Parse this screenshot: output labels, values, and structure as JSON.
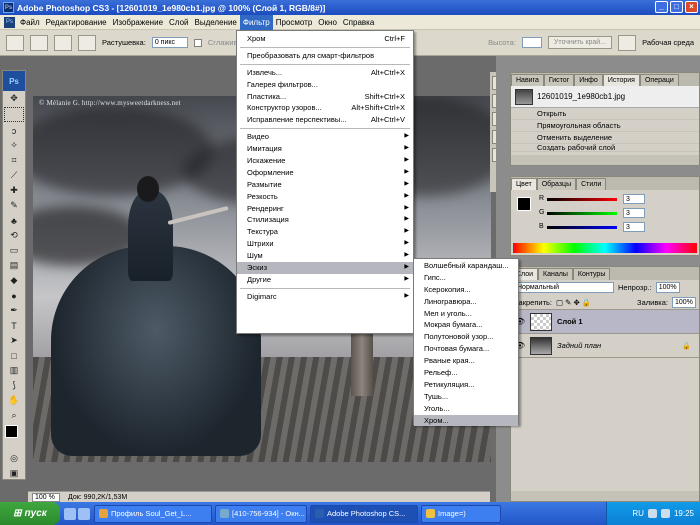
{
  "window": {
    "title": "Adobe Photoshop CS3 - [12601019_1e980cb1.jpg @ 100% (Слой 1, RGB/8#)]"
  },
  "menubar": [
    "Файл",
    "Редактирование",
    "Изображение",
    "Слой",
    "Выделение",
    "Фильтр",
    "Просмотр",
    "Окно",
    "Справка"
  ],
  "options": {
    "feather_label": "Растушевка:",
    "feather_value": "0 пикс",
    "antialias_label": "Сглаживание",
    "height_label": "Высота:",
    "refine_edge": "Уточнить край...",
    "workspace": "Рабочая среда"
  },
  "filter_menu": {
    "chrome": "Хром",
    "chrome_sc": "Ctrl+F",
    "smart": "Преобразовать для смарт-фильтров",
    "extract": "Извлечь...",
    "extract_sc": "Alt+Ctrl+X",
    "gallery": "Галерея фильтров...",
    "liquify": "Пластика...",
    "liquify_sc": "Shift+Ctrl+X",
    "pattern": "Конструктор узоров...",
    "pattern_sc": "Alt+Shift+Ctrl+X",
    "vanishing": "Исправление перспективы...",
    "vanishing_sc": "Alt+Ctrl+V",
    "video": "Видео",
    "imitation": "Имитация",
    "distort": "Искажение",
    "artistic": "Оформление",
    "blur": "Размытие",
    "sharpen": "Резкость",
    "render": "Рендеринг",
    "stylize": "Стилизация",
    "texture": "Текстура",
    "strokes": "Штрихи",
    "noise": "Шум",
    "sketch": "Эскиз",
    "other": "Другие",
    "digimarc": "Digimarc"
  },
  "sketch_menu": [
    "Волшебный карандаш...",
    "Гипс...",
    "Ксерокопия...",
    "Линогравюра...",
    "Мел и уголь...",
    "Мокрая бумага...",
    "Полутоновой узор...",
    "Почтовая бумага...",
    "Рваные края...",
    "Рельеф...",
    "Ретикуляция...",
    "Тушь...",
    "Уголь...",
    "Хром..."
  ],
  "image": {
    "watermark": "© Mélanie G.    http://www.mysweetdarkness.net"
  },
  "doc_status": {
    "zoom": "100 %",
    "info": "Док: 990,2K/1,53M"
  },
  "history_panel": {
    "tabs": [
      "Навига",
      "Гистог",
      "Инфо",
      "История",
      "Операци"
    ],
    "snapshot": "12601019_1e980cb1.jpg",
    "items": [
      "Открыть",
      "Прямоугольная область",
      "Отменить выделение",
      "Создать рабочий слой"
    ]
  },
  "color_panel": {
    "tabs": [
      "Цвет",
      "Образцы",
      "Стили"
    ],
    "r_label": "R",
    "g_label": "G",
    "b_label": "B",
    "r": "3",
    "g": "3",
    "b": "3",
    "colors": {
      "r": "#d01010",
      "g": "#10b010",
      "b": "#1010d0"
    }
  },
  "layers_panel": {
    "tabs": [
      "Слои",
      "Каналы",
      "Контуры"
    ],
    "blend": "Нормальный",
    "opacity_label": "Непрозр.:",
    "opacity": "100%",
    "lock_label": "Закрепить:",
    "fill_label": "Заливка:",
    "fill": "100%",
    "layers": [
      {
        "name": "Слой 1"
      },
      {
        "name": "Задний план"
      }
    ]
  },
  "taskbar": {
    "start": "пуск",
    "tasks": [
      "Профиль Soul_Get_L...",
      "[410-756-934] - Окн...",
      "Adobe Photoshop CS...",
      "Image=)"
    ],
    "lang": "RU",
    "time": "19:25"
  }
}
